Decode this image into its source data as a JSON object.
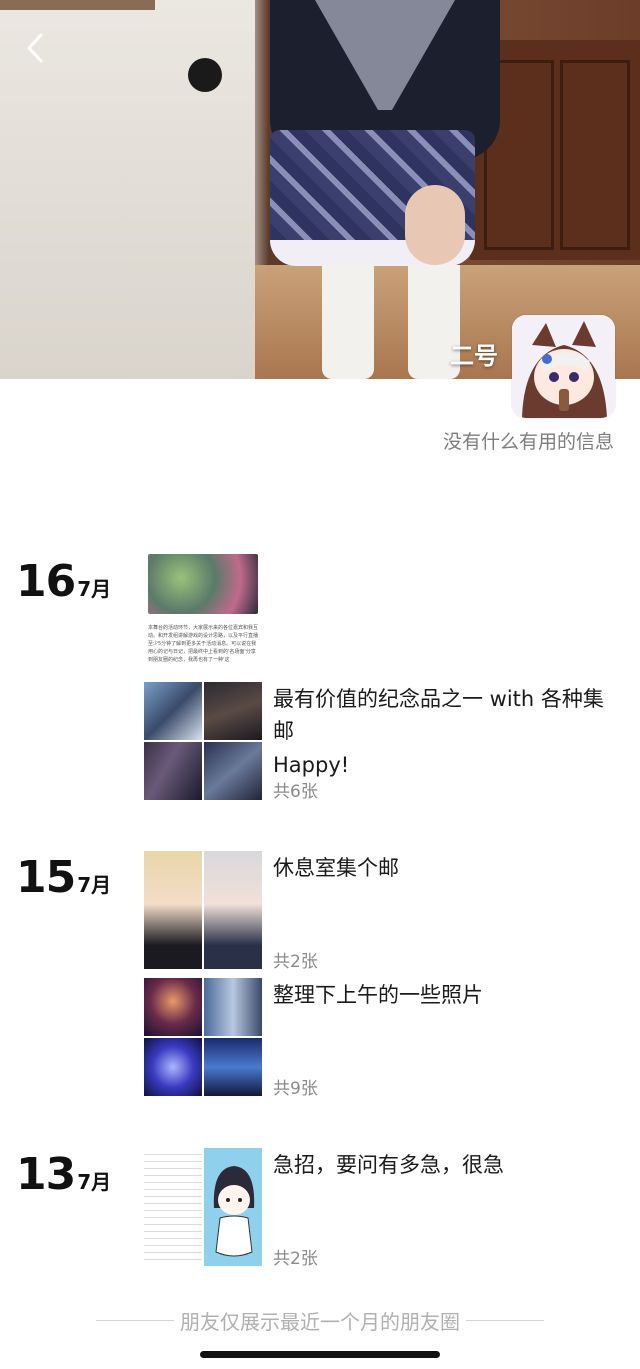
{
  "profile": {
    "name": "二号",
    "bio": "没有什么有用的信息"
  },
  "timeline": [
    {
      "day": "16",
      "month": "7月",
      "posts": [
        {
          "text": "最有价值的纪念品之一 with 各种集邮",
          "text2": "Happy!",
          "count": "共6张",
          "preview_caption": "本舞台的活动环节，大家展示来的各位嘉宾和我互动。和开发组讲解游戏的设计思路，以及平行直播至少5分钟了解到更多关于活动消息。可以说在我用心的记与日记，把最终中上看到的'名场面'分享到朋友圈的纪念，我再也有了一种'这"
        }
      ]
    },
    {
      "day": "15",
      "month": "7月",
      "posts": [
        {
          "text": "休息室集个邮",
          "count": "共2张"
        },
        {
          "text": "整理下上午的一些照片",
          "count": "共9张"
        }
      ]
    },
    {
      "day": "13",
      "month": "7月",
      "posts": [
        {
          "text": "急招，要问有多急，很急",
          "count": "共2张"
        }
      ]
    }
  ],
  "footer": {
    "note": "朋友仅展示最近一个月的朋友圈"
  },
  "colors": {
    "background": "#ffffff",
    "muted_text": "#7d7d7d",
    "count_text": "#8a8a8a"
  }
}
